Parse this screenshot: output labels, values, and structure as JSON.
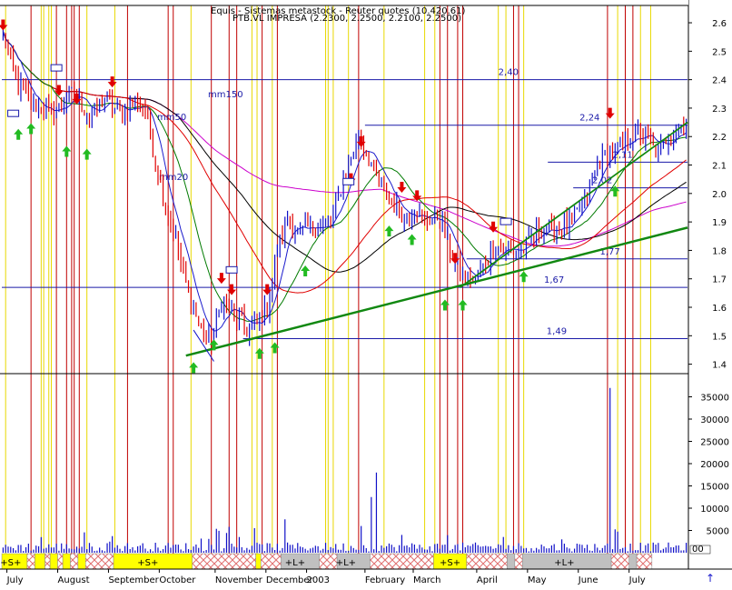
{
  "header": {
    "line1": "Equis - Sistemas metastock - Reuter quotes (10.420.61)",
    "line2": "PTB.VL IMPRESA (2.2300, 2.2500, 2.2100, 2.2500)"
  },
  "chart_data": {
    "type": "bar",
    "title": "PTB.VL IMPRESA",
    "price_axis": {
      "ylim": [
        1.37,
        2.68
      ],
      "ticks": [
        1.4,
        1.5,
        1.6,
        1.7,
        1.8,
        1.9,
        2.0,
        2.1,
        2.2,
        2.3,
        2.4,
        2.5,
        2.6
      ]
    },
    "volume_axis": {
      "ylim": [
        0,
        40000
      ],
      "ticks": [
        5000,
        10000,
        15000,
        20000,
        25000,
        30000,
        35000
      ]
    },
    "months": [
      "July",
      "August",
      "September",
      "October",
      "November",
      "December",
      "2003",
      "February",
      "March",
      "April",
      "May",
      "June",
      "July"
    ],
    "levels": [
      {
        "label": "2,40",
        "value": 2.4
      },
      {
        "label": "2,24",
        "value": 2.24
      },
      {
        "label": "2,11",
        "value": 2.11
      },
      {
        "label": "2,02",
        "value": 2.02
      },
      {
        "label": "1,77",
        "value": 1.77
      },
      {
        "label": "1,67",
        "value": 1.67
      },
      {
        "label": "1,49",
        "value": 1.49
      }
    ],
    "ma_labels": [
      "mm150",
      "mm50",
      "mm20"
    ],
    "price_key": {
      "x": [
        0,
        6,
        12,
        20,
        28,
        34,
        40,
        46,
        52,
        56,
        60,
        64,
        68,
        70,
        74,
        78,
        82,
        86,
        90,
        96,
        100,
        104,
        108,
        112,
        116,
        120,
        126,
        130,
        134,
        140,
        146,
        152,
        158,
        162,
        166,
        172,
        176,
        180,
        186,
        190,
        194,
        198,
        204,
        210,
        214,
        218,
        224,
        230,
        234,
        238,
        244,
        250,
        254,
        258,
        262,
        268
      ],
      "y": [
        2.56,
        2.38,
        2.31,
        2.28,
        2.36,
        2.27,
        2.33,
        2.28,
        2.32,
        2.3,
        2.12,
        1.95,
        1.85,
        1.75,
        1.62,
        1.52,
        1.48,
        1.62,
        1.58,
        1.52,
        1.55,
        1.6,
        1.8,
        1.92,
        1.85,
        1.88,
        1.88,
        1.92,
        2.05,
        2.2,
        2.08,
        1.98,
        1.92,
        1.95,
        1.9,
        1.92,
        1.8,
        1.72,
        1.69,
        1.76,
        1.82,
        1.8,
        1.8,
        1.86,
        1.88,
        1.87,
        1.9,
        1.99,
        2.1,
        2.14,
        2.17,
        2.21,
        2.19,
        2.14,
        2.21,
        2.24
      ]
    },
    "volume_key": [
      {
        "bar": 15,
        "value": 3500
      },
      {
        "bar": 42,
        "value": 2500
      },
      {
        "bar": 111,
        "value": 7500
      },
      {
        "bar": 147,
        "value": 18000
      },
      {
        "bar": 141,
        "value": 6000
      },
      {
        "bar": 145,
        "value": 12500
      },
      {
        "bar": 157,
        "value": 4000
      },
      {
        "bar": 239,
        "value": 37000
      },
      {
        "bar": 220,
        "value": 3000
      }
    ],
    "signal_labels": [
      "+S+",
      "+S+",
      "+L+",
      "+L+",
      "+S+",
      "+L+"
    ],
    "colors": {
      "price_up": "#1010c8",
      "price_down": "#e00000",
      "mm20": "#1a1acc",
      "mm50": "#007a00",
      "mm150": "#cc00cc",
      "mm_extra": "#000000",
      "support_trend": "#118811",
      "sell_arrow": "#e00000",
      "buy_arrow": "#22bb22",
      "signal_yellow": "#ffff00",
      "signal_gray": "#c0c0c0",
      "signal_hatch": "#e07070",
      "vline_red": "#c00000",
      "vline_yellow": "#e8d800"
    }
  },
  "footer": {
    "up_arrow": "↑",
    "small_box": "00"
  }
}
